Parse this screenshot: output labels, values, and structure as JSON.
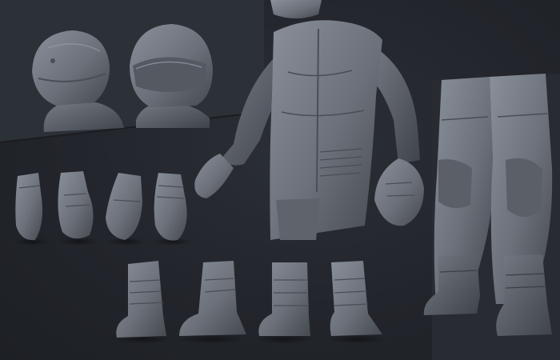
{
  "scene": {
    "background_color": "#23262c",
    "panel_color": "#2c3037",
    "model_color": "#6b7079",
    "model_highlight": "#8a909a",
    "model_shadow": "#3f434b",
    "seam_color": "#4a4e56"
  },
  "objects": [
    {
      "kind": "helmet",
      "view": "back",
      "count": 1
    },
    {
      "kind": "helmet",
      "view": "front",
      "count": 1
    },
    {
      "kind": "jacket-torso",
      "count": 1
    },
    {
      "kind": "glove",
      "count": 4
    },
    {
      "kind": "riding-pants",
      "count": 1
    },
    {
      "kind": "boot",
      "count": 4
    }
  ]
}
